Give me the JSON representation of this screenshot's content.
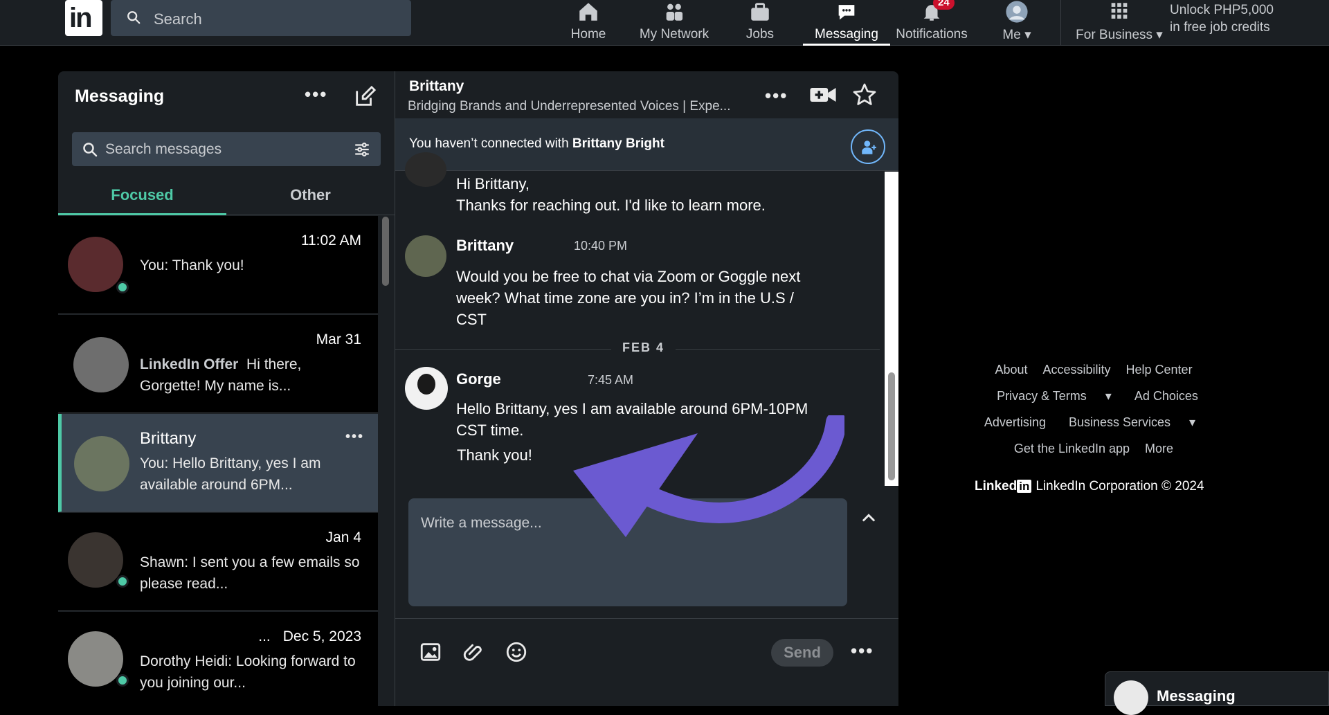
{
  "topnav": {
    "search_placeholder": "Search",
    "items": [
      {
        "label": "Home"
      },
      {
        "label": "My Network"
      },
      {
        "label": "Jobs"
      },
      {
        "label": "Messaging"
      },
      {
        "label": "Notifications",
        "badge": "24"
      },
      {
        "label": "Me"
      },
      {
        "label": "For Business"
      }
    ],
    "unlock_line1": "Unlock PHP5,000",
    "unlock_line2": "in free job credits"
  },
  "messaging": {
    "title": "Messaging",
    "search_placeholder": "Search messages",
    "tabs": [
      {
        "label": "Focused"
      },
      {
        "label": "Other"
      }
    ],
    "conversations": [
      {
        "name": "",
        "date": "11:02 AM",
        "snippet": "You: Thank you!"
      },
      {
        "name": "",
        "date": "Mar 31",
        "snippet_bold": "LinkedIn Offer",
        "snippet": "Hi there, Gorgette! My name is..."
      },
      {
        "name": "Brittany",
        "date": "",
        "snippet": "You: Hello Brittany, yes I am available around 6PM..."
      },
      {
        "name": "",
        "date": "Jan 4",
        "snippet": "Shawn: I sent you a few emails so please read..."
      },
      {
        "name": "...",
        "date": "Dec 5, 2023",
        "snippet": "Dorothy Heidi: Looking forward to you joining our..."
      }
    ]
  },
  "thread": {
    "name": "Brittany",
    "headline": "Bridging Brands and Underrepresented Voices | Expe...",
    "connect_notice_prefix": "You haven’t connected with",
    "connect_notice_name": "Brittany Bright",
    "messages": [
      {
        "sender": "",
        "time": "",
        "lines": [
          "Hi Brittany,",
          "Thanks for reaching out. I'd like to learn more."
        ]
      },
      {
        "sender": "Brittany",
        "time": "10:40 PM",
        "lines": [
          "Would you be free to chat via Zoom or Goggle next",
          "week? What time zone are you in? I’m in the U.S /",
          "CST"
        ]
      },
      {
        "sender": "Gorge",
        "time": "7:45 AM",
        "lines": [
          "Hello Brittany, yes I am available around 6PM-10PM",
          "CST time.",
          "Thank you!"
        ]
      }
    ],
    "day_separator": "FEB 4",
    "compose_placeholder": "Write a message...",
    "send_label": "Send"
  },
  "footer": {
    "links_row1": [
      "About",
      "Accessibility",
      "Help Center"
    ],
    "links_row2": [
      "Privacy & Terms",
      "Ad Choices"
    ],
    "links_row3": [
      "Advertising",
      "Business Services"
    ],
    "links_row4": [
      "Get the LinkedIn app",
      "More"
    ],
    "corp_brand": "Linked",
    "corp_in": "in",
    "corp_text": "LinkedIn Corporation © 2024"
  },
  "mini_messaging": {
    "label": "Messaging"
  },
  "colors": {
    "accent": "#4ec9a6",
    "badge": "#cb112d",
    "arrow": "#6b5ad1"
  }
}
